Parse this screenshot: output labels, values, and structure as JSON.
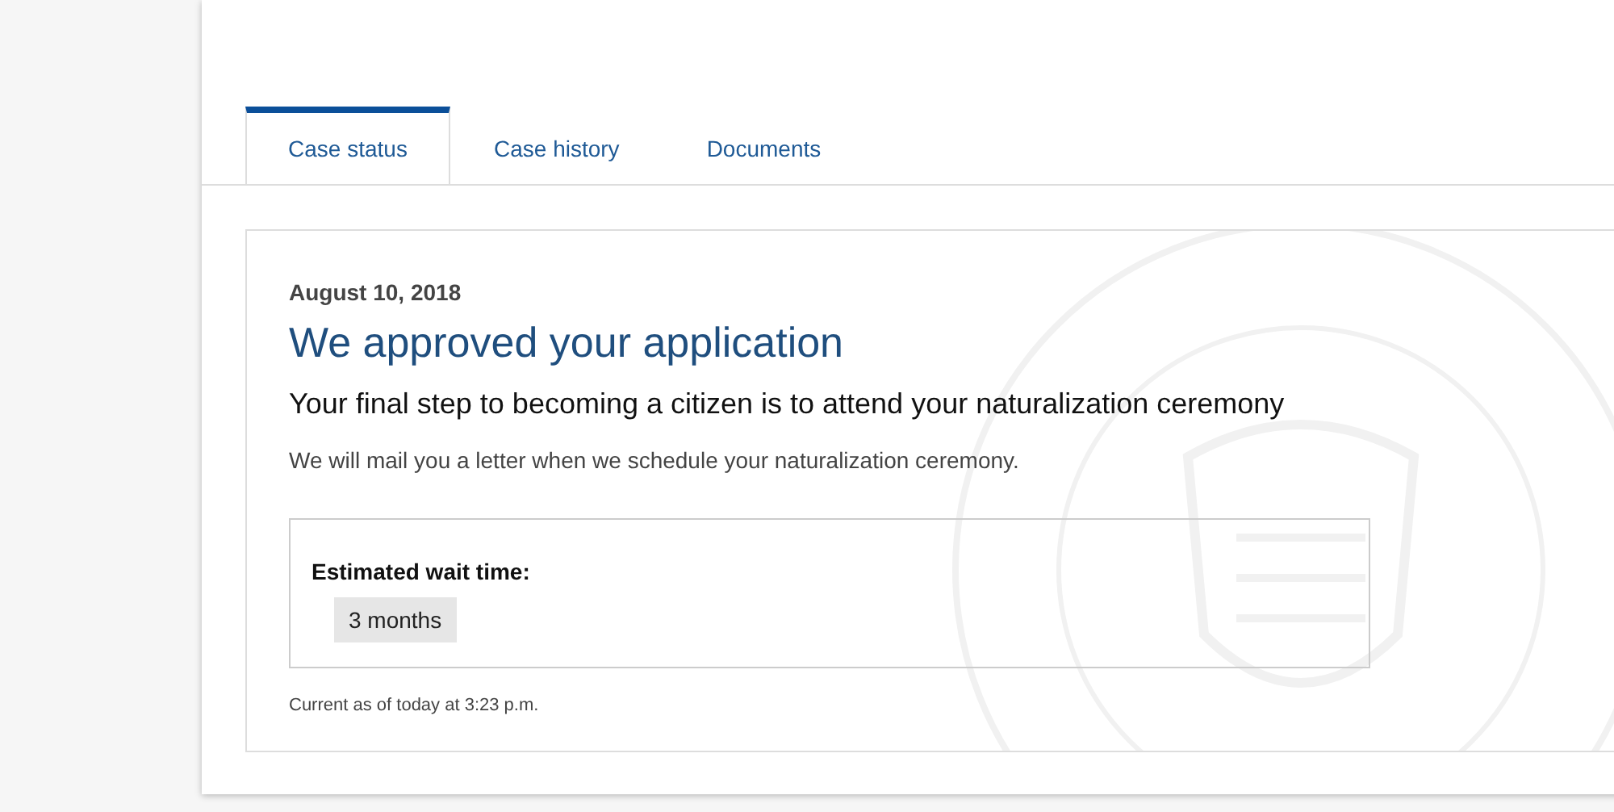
{
  "tabs": [
    {
      "label": "Case status",
      "selected": true
    },
    {
      "label": "Case history",
      "selected": false
    },
    {
      "label": "Documents",
      "selected": false
    }
  ],
  "status": {
    "date": "August 10, 2018",
    "title": "We approved your application",
    "subtitle": "Your final step to becoming a citizen is to attend your naturalization ceremony",
    "message": "We will mail you a letter when we schedule your naturalization ceremony.",
    "wait": {
      "label": "Estimated wait time:",
      "value": "3 months"
    },
    "updated": "Current as of today at 3:23 p.m."
  }
}
